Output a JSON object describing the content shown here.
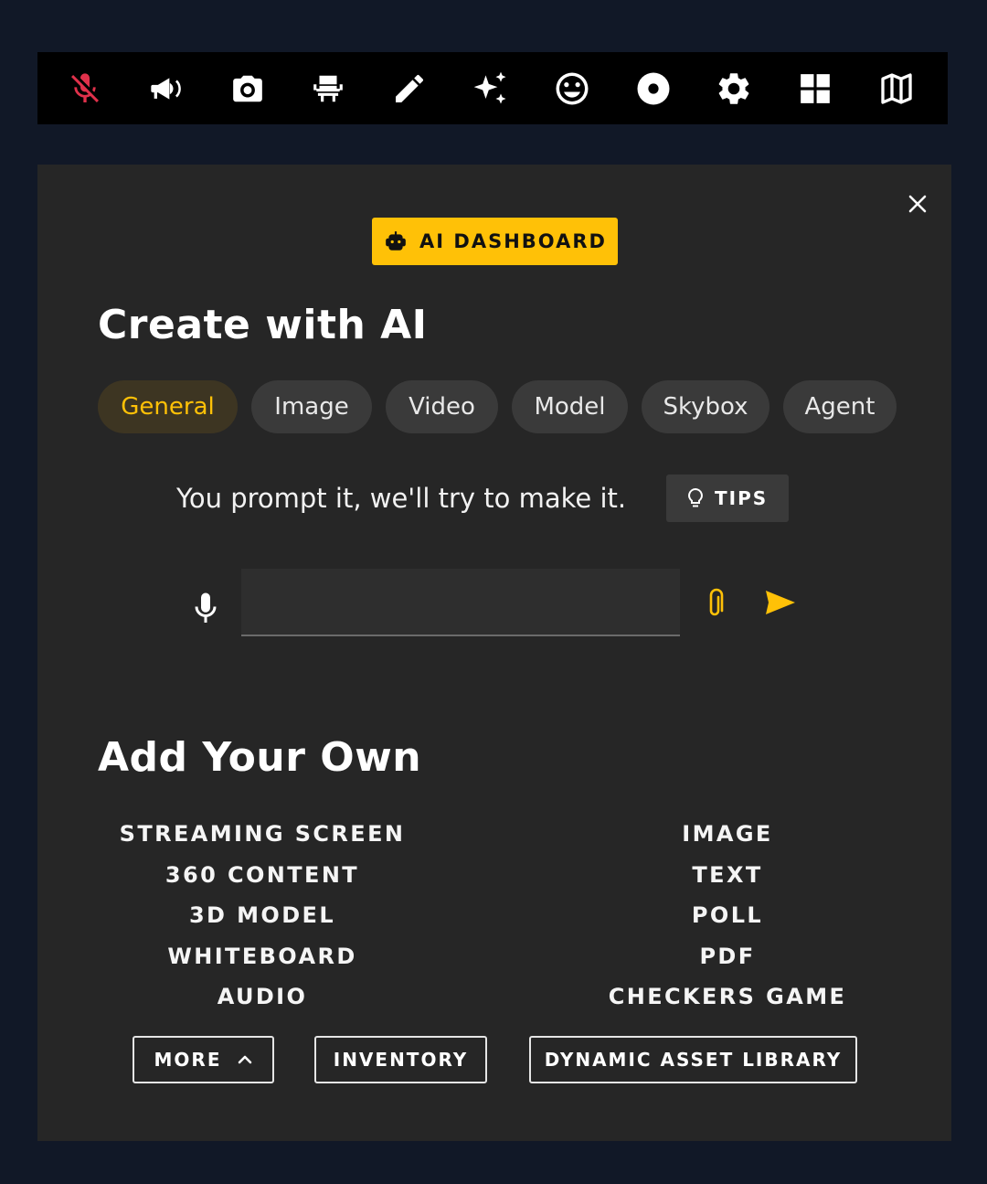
{
  "toolbar": {
    "icons": [
      "mic-off-icon",
      "megaphone-icon",
      "camera-icon",
      "seat-icon",
      "pencil-icon",
      "sparkles-icon",
      "smiley-icon",
      "record-icon",
      "gear-icon",
      "grid-icon",
      "map-icon"
    ],
    "mic_off_color": "#e0314b"
  },
  "panel": {
    "ai_dashboard_label": "AI DASHBOARD",
    "create_title": "Create with AI",
    "tabs": [
      "General",
      "Image",
      "Video",
      "Model",
      "Skybox",
      "Agent"
    ],
    "active_tab": "General",
    "prompt_hint": "You prompt it, we'll try to make it.",
    "tips_label": "TIPS",
    "prompt_input_value": "",
    "prompt_input_placeholder": "",
    "add_title": "Add Your Own",
    "add_left": [
      "STREAMING SCREEN",
      "360 CONTENT",
      "3D MODEL",
      "WHITEBOARD",
      "AUDIO"
    ],
    "add_right": [
      "IMAGE",
      "TEXT",
      "POLL",
      "PDF",
      "CHECKERS GAME"
    ],
    "more_label": "MORE",
    "inventory_label": "INVENTORY",
    "dal_label": "DYNAMIC ASSET LIBRARY"
  },
  "colors": {
    "accent": "#ffc107",
    "panel_bg": "#262626",
    "page_bg": "#111827"
  }
}
